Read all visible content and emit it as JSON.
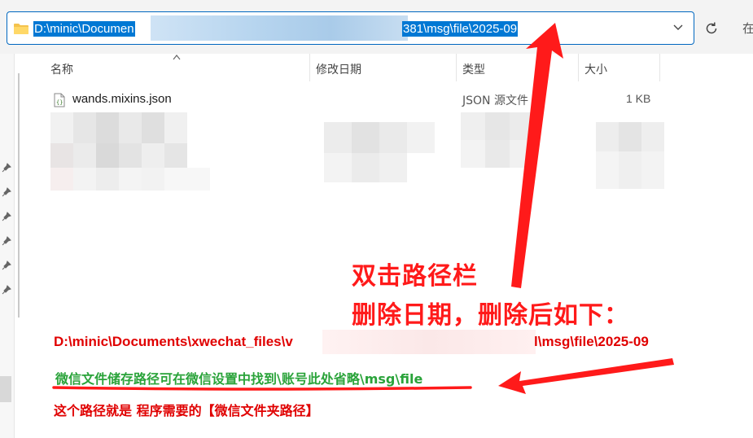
{
  "address_bar": {
    "path_visible_start": "D:\\minic\\Documen",
    "path_visible_end": "381\\msg\\file\\2025-09"
  },
  "cut_off_text": "在",
  "columns": [
    "名称",
    "修改日期",
    "类型",
    "大小"
  ],
  "file": {
    "name": "wands.mixins.json",
    "type": "JSON 源文件",
    "size": "1 KB"
  },
  "annotations": {
    "line1": "双击路径栏",
    "line2": "删除日期，删除后如下：",
    "path_start": "D:\\minic\\Documents\\xwechat_files\\v",
    "path_end": "l\\msg\\file\\2025-09",
    "green_note": "微信文件储存路径可在微信设置中找到\\账号此处省略\\msg\\file",
    "red_note": "这个路径就是 程序需要的【微信文件夹路径】",
    "accent_red": "#ff1a1a",
    "accent_green": "#2aa33a"
  }
}
